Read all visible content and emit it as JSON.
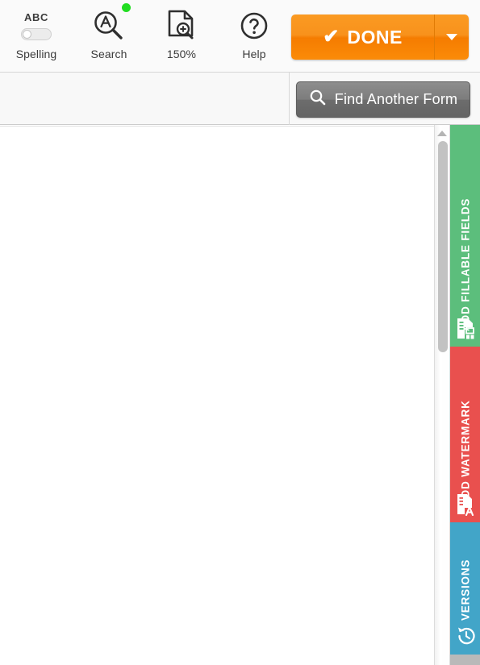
{
  "toolbar": {
    "tools": [
      {
        "id": "spelling",
        "icon": "abc-toggle-icon",
        "abc_label": "ABC",
        "caption": "Spelling",
        "toggle_on": false
      },
      {
        "id": "search",
        "icon": "magnifier-a-icon",
        "caption": "Search",
        "has_status_dot": true,
        "status_color": "#22dd22"
      },
      {
        "id": "zoom",
        "icon": "document-zoom-icon",
        "caption": "150%"
      },
      {
        "id": "help",
        "icon": "question-circle-icon",
        "caption": "Help"
      }
    ],
    "done_button": {
      "label": "DONE",
      "check_icon": "checkmark-icon",
      "dropdown_icon": "chevron-down-icon",
      "color": "#f58220"
    }
  },
  "subbar": {
    "find_button": {
      "label": "Find Another Form",
      "icon": "search-icon"
    }
  },
  "scrollbar": {
    "up_arrow_icon": "chevron-up-icon",
    "orientation": "vertical"
  },
  "panels": [
    {
      "id": "add-fillable-fields",
      "label": "ADD FILLABLE FIELDS",
      "color": "#5cbe7c",
      "icon": "document-form-fields-icon"
    },
    {
      "id": "add-watermark",
      "label": "ADD WATERMARK",
      "color": "#e9504e",
      "icon": "document-letter-a-icon"
    },
    {
      "id": "versions",
      "label": "VERSIONS",
      "color": "#42a5c8",
      "icon": "clock-history-icon"
    }
  ]
}
